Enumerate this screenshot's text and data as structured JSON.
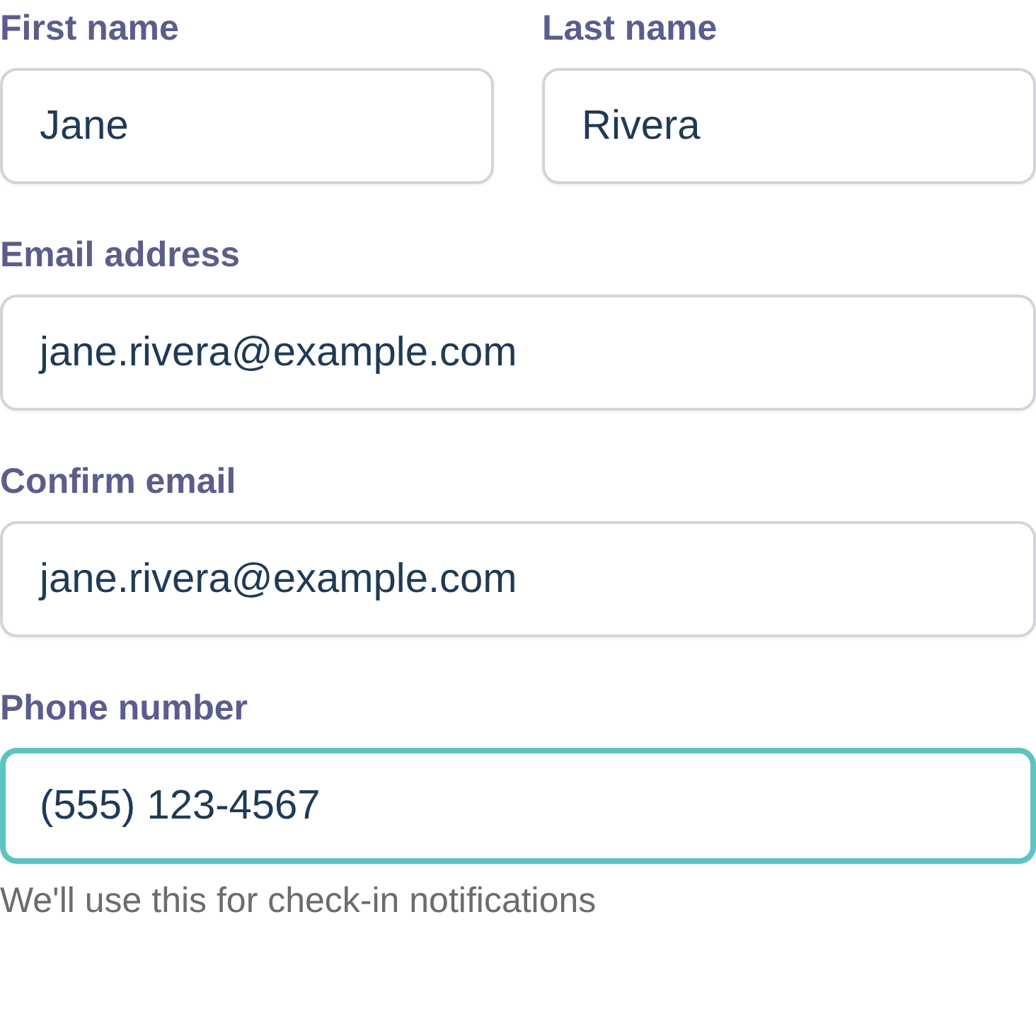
{
  "rows": [
    {
      "fields": [
        {
          "label": "First name",
          "value": "Jane",
          "focused": false
        },
        {
          "label": "Last name",
          "value": "Rivera",
          "focused": false
        }
      ]
    },
    {
      "fields": [
        {
          "label": "Email address",
          "value": "jane.rivera@example.com",
          "focused": false
        }
      ]
    },
    {
      "fields": [
        {
          "label": "Confirm email",
          "value": "jane.rivera@example.com",
          "focused": false
        }
      ]
    },
    {
      "fields": [
        {
          "label": "Phone number",
          "value": "(555) 123-4567",
          "focused": true,
          "hint": "We'll use this for check-in notifications"
        }
      ]
    }
  ]
}
